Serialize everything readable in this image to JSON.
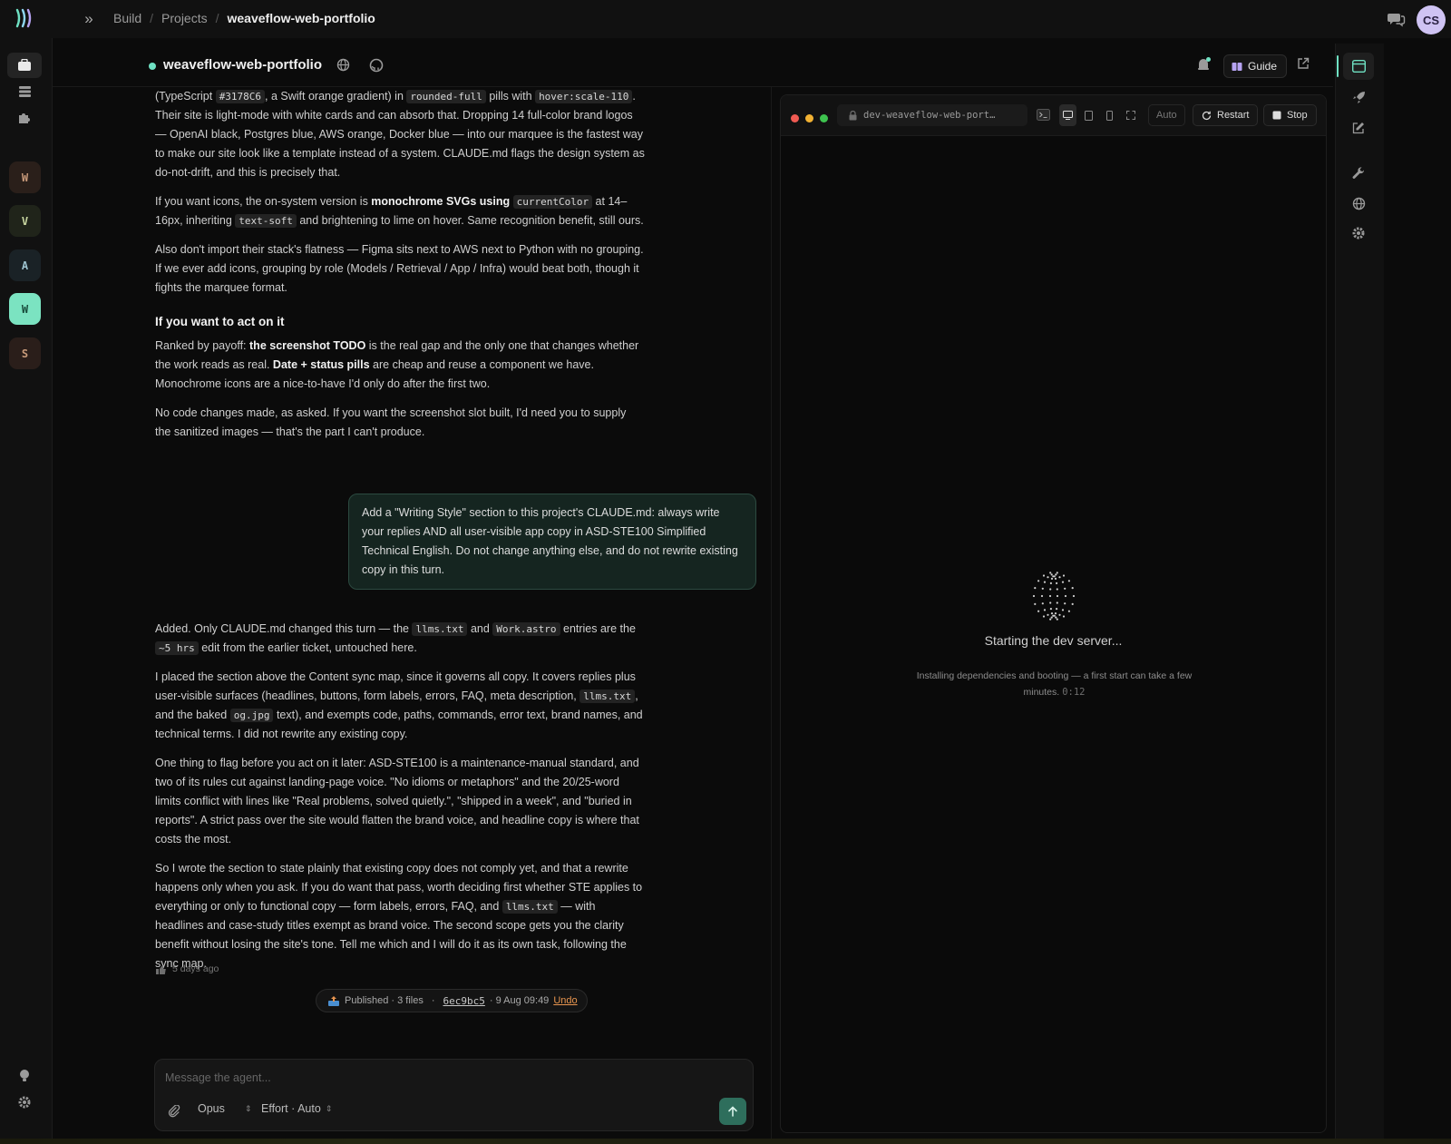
{
  "breadcrumb": {
    "build": "Build",
    "projects": "Projects",
    "current": "weaveflow-web-portfolio"
  },
  "user": {
    "initials": "CS"
  },
  "workspaces": [
    {
      "letter": "W",
      "color": "#c99a7a",
      "bg": "#2a1f1a"
    },
    {
      "letter": "V",
      "color": "#c8d6a0",
      "bg": "#20241a"
    },
    {
      "letter": "A",
      "color": "#9ec3cf",
      "bg": "#1a2226"
    },
    {
      "letter": "W",
      "color": "#174a3a",
      "bg": "#7be3c1"
    },
    {
      "letter": "S",
      "color": "#c79a7a",
      "bg": "#2a1e1a"
    }
  ],
  "project": {
    "name": "weaveflow-web-portfolio",
    "status_color": "#6fe1c3",
    "guide_label": "Guide"
  },
  "chat": {
    "p1": {
      "a": "(TypeScript ",
      "c1": "#3178C6",
      "b": ", a Swift orange gradient) in ",
      "c2": "rounded-full",
      "c": " pills with ",
      "c3": "hover:scale-110",
      "d": ". Their site is light-mode with white cards and can absorb that. Dropping 14 full-color brand logos — OpenAI black, Postgres blue, AWS orange, Docker blue — into our marquee is the fastest way to make our site look like a template instead of a system. CLAUDE.md flags the design system as do-not-drift, and this is precisely that."
    },
    "p2": {
      "a": "If you want icons, the on-system version is ",
      "b1": "monochrome SVGs using",
      "c1": "currentColor",
      "b": " at 14–16px, inheriting ",
      "c2": "text-soft",
      "c": " and brightening to lime on hover. Same recognition benefit, still ours."
    },
    "p3": "Also don't import their stack's flatness — Figma sits next to AWS next to Python with no grouping. If we ever add icons, grouping by role (Models / Retrieval / App / Infra) would beat both, though it fights the marquee format.",
    "heading": "If you want to act on it",
    "p4": {
      "a": "Ranked by payoff: ",
      "b1": "the screenshot TODO",
      "b": " is the real gap and the only one that changes whether the work reads as real. ",
      "b2": "Date + status pills",
      "c": " are cheap and reuse a component we have. Monochrome icons are a nice-to-have I'd only do after the first two."
    },
    "p5": "No code changes made, as asked. If you want the screenshot slot built, I'd need you to supply the sanitized images — that's the part I can't produce.",
    "user_message": "Add a \"Writing Style\" section to this project's CLAUDE.md: always write your replies AND all user-visible app copy in ASD-STE100 Simplified Technical English. Do not change anything else, and do not rewrite existing copy in this turn.",
    "p6": {
      "a": "Added. Only CLAUDE.md changed this turn — the ",
      "c1": "llms.txt",
      "b": " and ",
      "c2": "Work.astro",
      "c": " entries are the ",
      "c3": "~5 hrs",
      "d": " edit from the earlier ticket, untouched here."
    },
    "p7": {
      "a": "I placed the section above the Content sync map, since it governs all copy. It covers replies plus user-visible surfaces (headlines, buttons, form labels, errors, FAQ, meta description, ",
      "c1": "llms.txt",
      "b": ", and the baked ",
      "c2": "og.jpg",
      "c": " text), and exempts code, paths, commands, error text, brand names, and technical terms. I did not rewrite any existing copy."
    },
    "p8": "One thing to flag before you act on it later: ASD-STE100 is a maintenance-manual standard, and two of its rules cut against landing-page voice. \"No idioms or metaphors\" and the 20/25-word limits conflict with lines like \"Real problems, solved quietly.\", \"shipped in a week\", and \"buried in reports\". A strict pass over the site would flatten the brand voice, and headline copy is where that costs the most.",
    "p9": {
      "a": "So I wrote the section to state plainly that existing copy does not comply yet, and that a rewrite happens only when you ask. If you do want that pass, worth deciding first whether STE applies to everything or only to functional copy — form labels, errors, FAQ, and ",
      "c1": "llms.txt",
      "b": " — with headlines and case-study titles exempt as brand voice. The second scope gets you the clarity benefit without losing the site's tone. Tell me which and I will do it as its own task, following the sync map."
    },
    "timestamp": "5 days ago"
  },
  "published": {
    "label": "Published · 3 files",
    "sep": "·",
    "hash": "6ec9bc5",
    "date": "· 9 Aug 09:49",
    "undo": "Undo"
  },
  "composer": {
    "placeholder": "Message the agent...",
    "model": "Opus",
    "effort": "Effort · Auto"
  },
  "preview": {
    "url": "dev-weaveflow-web-port…",
    "auto": "Auto",
    "restart": "Restart",
    "stop": "Stop",
    "title": "Starting the dev server...",
    "subtitle": "Installing dependencies and booting — a first start can take a few minutes.",
    "timer": "0:12"
  },
  "colors": {
    "accent": "#6fe1c3",
    "bubble_bg": "#152520",
    "undo": "#e8954f",
    "send": "#2e6e5c"
  }
}
